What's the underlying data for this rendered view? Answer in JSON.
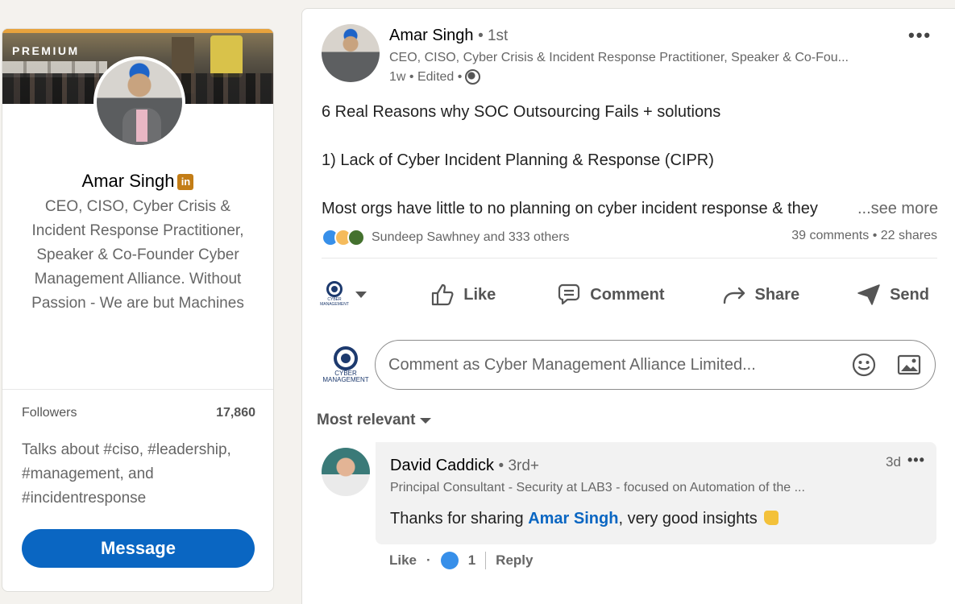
{
  "profile": {
    "badge": "PREMIUM",
    "name": "Amar Singh",
    "in_badge": "in",
    "headline": "CEO, CISO, Cyber Crisis & Incident Response Practitioner, Speaker & Co-Founder Cyber Management Alliance. Without Passion - We are but Machines",
    "followers_label": "Followers",
    "followers_count": "17,860",
    "talks_about": "Talks about #ciso, #leadership, #management, and #incidentresponse",
    "message_button": "Message"
  },
  "post": {
    "author": "Amar Singh",
    "degree": "• 1st",
    "subtitle": "CEO, CISO, Cyber Crisis & Incident Response Practitioner, Speaker & Co-Fou...",
    "time": "1w • Edited •",
    "more": "•••",
    "line1": "6 Real Reasons why SOC Outsourcing Fails + solutions",
    "line2": "1) Lack of Cyber Incident Planning & Response (CIPR)",
    "line3": "Most orgs have little to no planning on cyber incident response & they",
    "see_more": "...see more",
    "reactions_text": "Sundeep Sawhney and 333 others",
    "engagement": "39 comments • 22 shares",
    "actions": {
      "like": "Like",
      "comment": "Comment",
      "share": "Share",
      "send": "Send"
    },
    "company_logo_text": "CYBER MANAGEMENT",
    "comment_placeholder": "Comment as Cyber Management Alliance Limited...",
    "sort_label": "Most relevant"
  },
  "comment": {
    "author": "David Caddick",
    "degree": "• 3rd+",
    "time": "3d",
    "more": "•••",
    "subtitle": "Principal Consultant - Security at LAB3 - focused on Automation of the ...",
    "text_before": "Thanks for sharing ",
    "mention": "Amar Singh",
    "text_after": ", very good insights",
    "like_label": "Like",
    "dot": "·",
    "like_count": "1",
    "reply_label": "Reply"
  }
}
